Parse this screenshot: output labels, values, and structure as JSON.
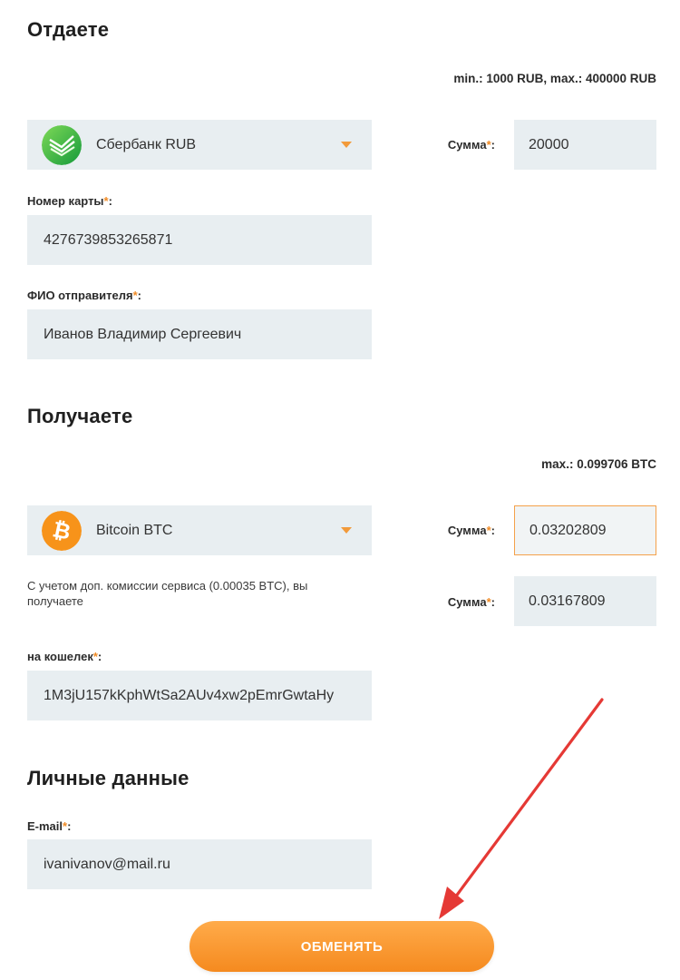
{
  "give": {
    "title": "Отдаете",
    "limits": "min.: 1000 RUB, max.: 400000 RUB",
    "currency": {
      "name": "Сбербанк RUB",
      "icon": "sberbank-icon"
    },
    "amount_label": "Сумма",
    "amount_value": "20000",
    "card_label": "Номер карты",
    "card_value": "4276739853265871",
    "sender_label": "ФИО отправителя",
    "sender_value": "Иванов Владимир Сергеевич"
  },
  "receive": {
    "title": "Получаете",
    "limits": "max.: 0.099706 BTC",
    "currency": {
      "name": "Bitcoin BTC",
      "icon": "bitcoin-icon"
    },
    "amount_label": "Сумма",
    "amount_value": "0.03202809",
    "fee_note": "С учетом доп. комиссии сервиса (0.00035 BTC), вы получаете",
    "net_amount_label": "Сумма",
    "net_amount_value": "0.03167809",
    "wallet_label": "на кошелек",
    "wallet_value": "1M3jU157kKphWtSa2AUv4xw2pEmrGwtaHy"
  },
  "personal": {
    "title": "Личные данные",
    "email_label": "E-mail",
    "email_value": "ivanivanov@mail.ru"
  },
  "required_mark": "*",
  "submit_label": "ОБМЕНЯТЬ",
  "colors": {
    "accent": "#f58a1f",
    "field_bg": "#e8eef1",
    "arrow": "#e53935"
  }
}
